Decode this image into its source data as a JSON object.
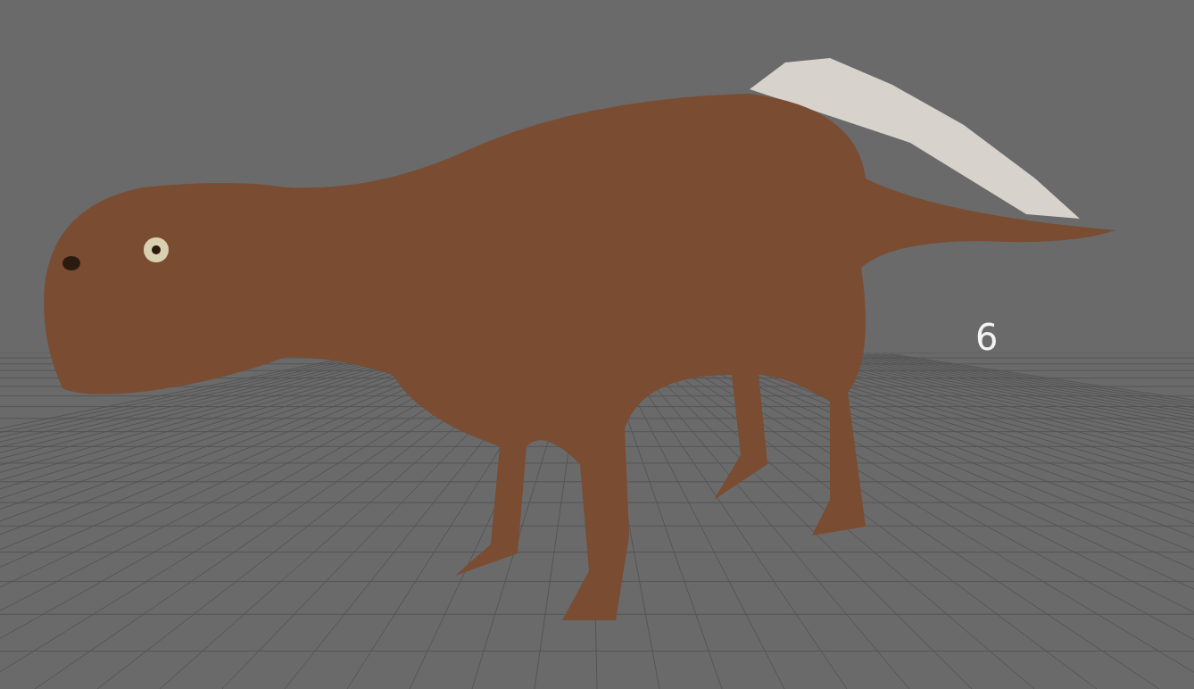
{
  "viewport": {
    "label": "6"
  }
}
